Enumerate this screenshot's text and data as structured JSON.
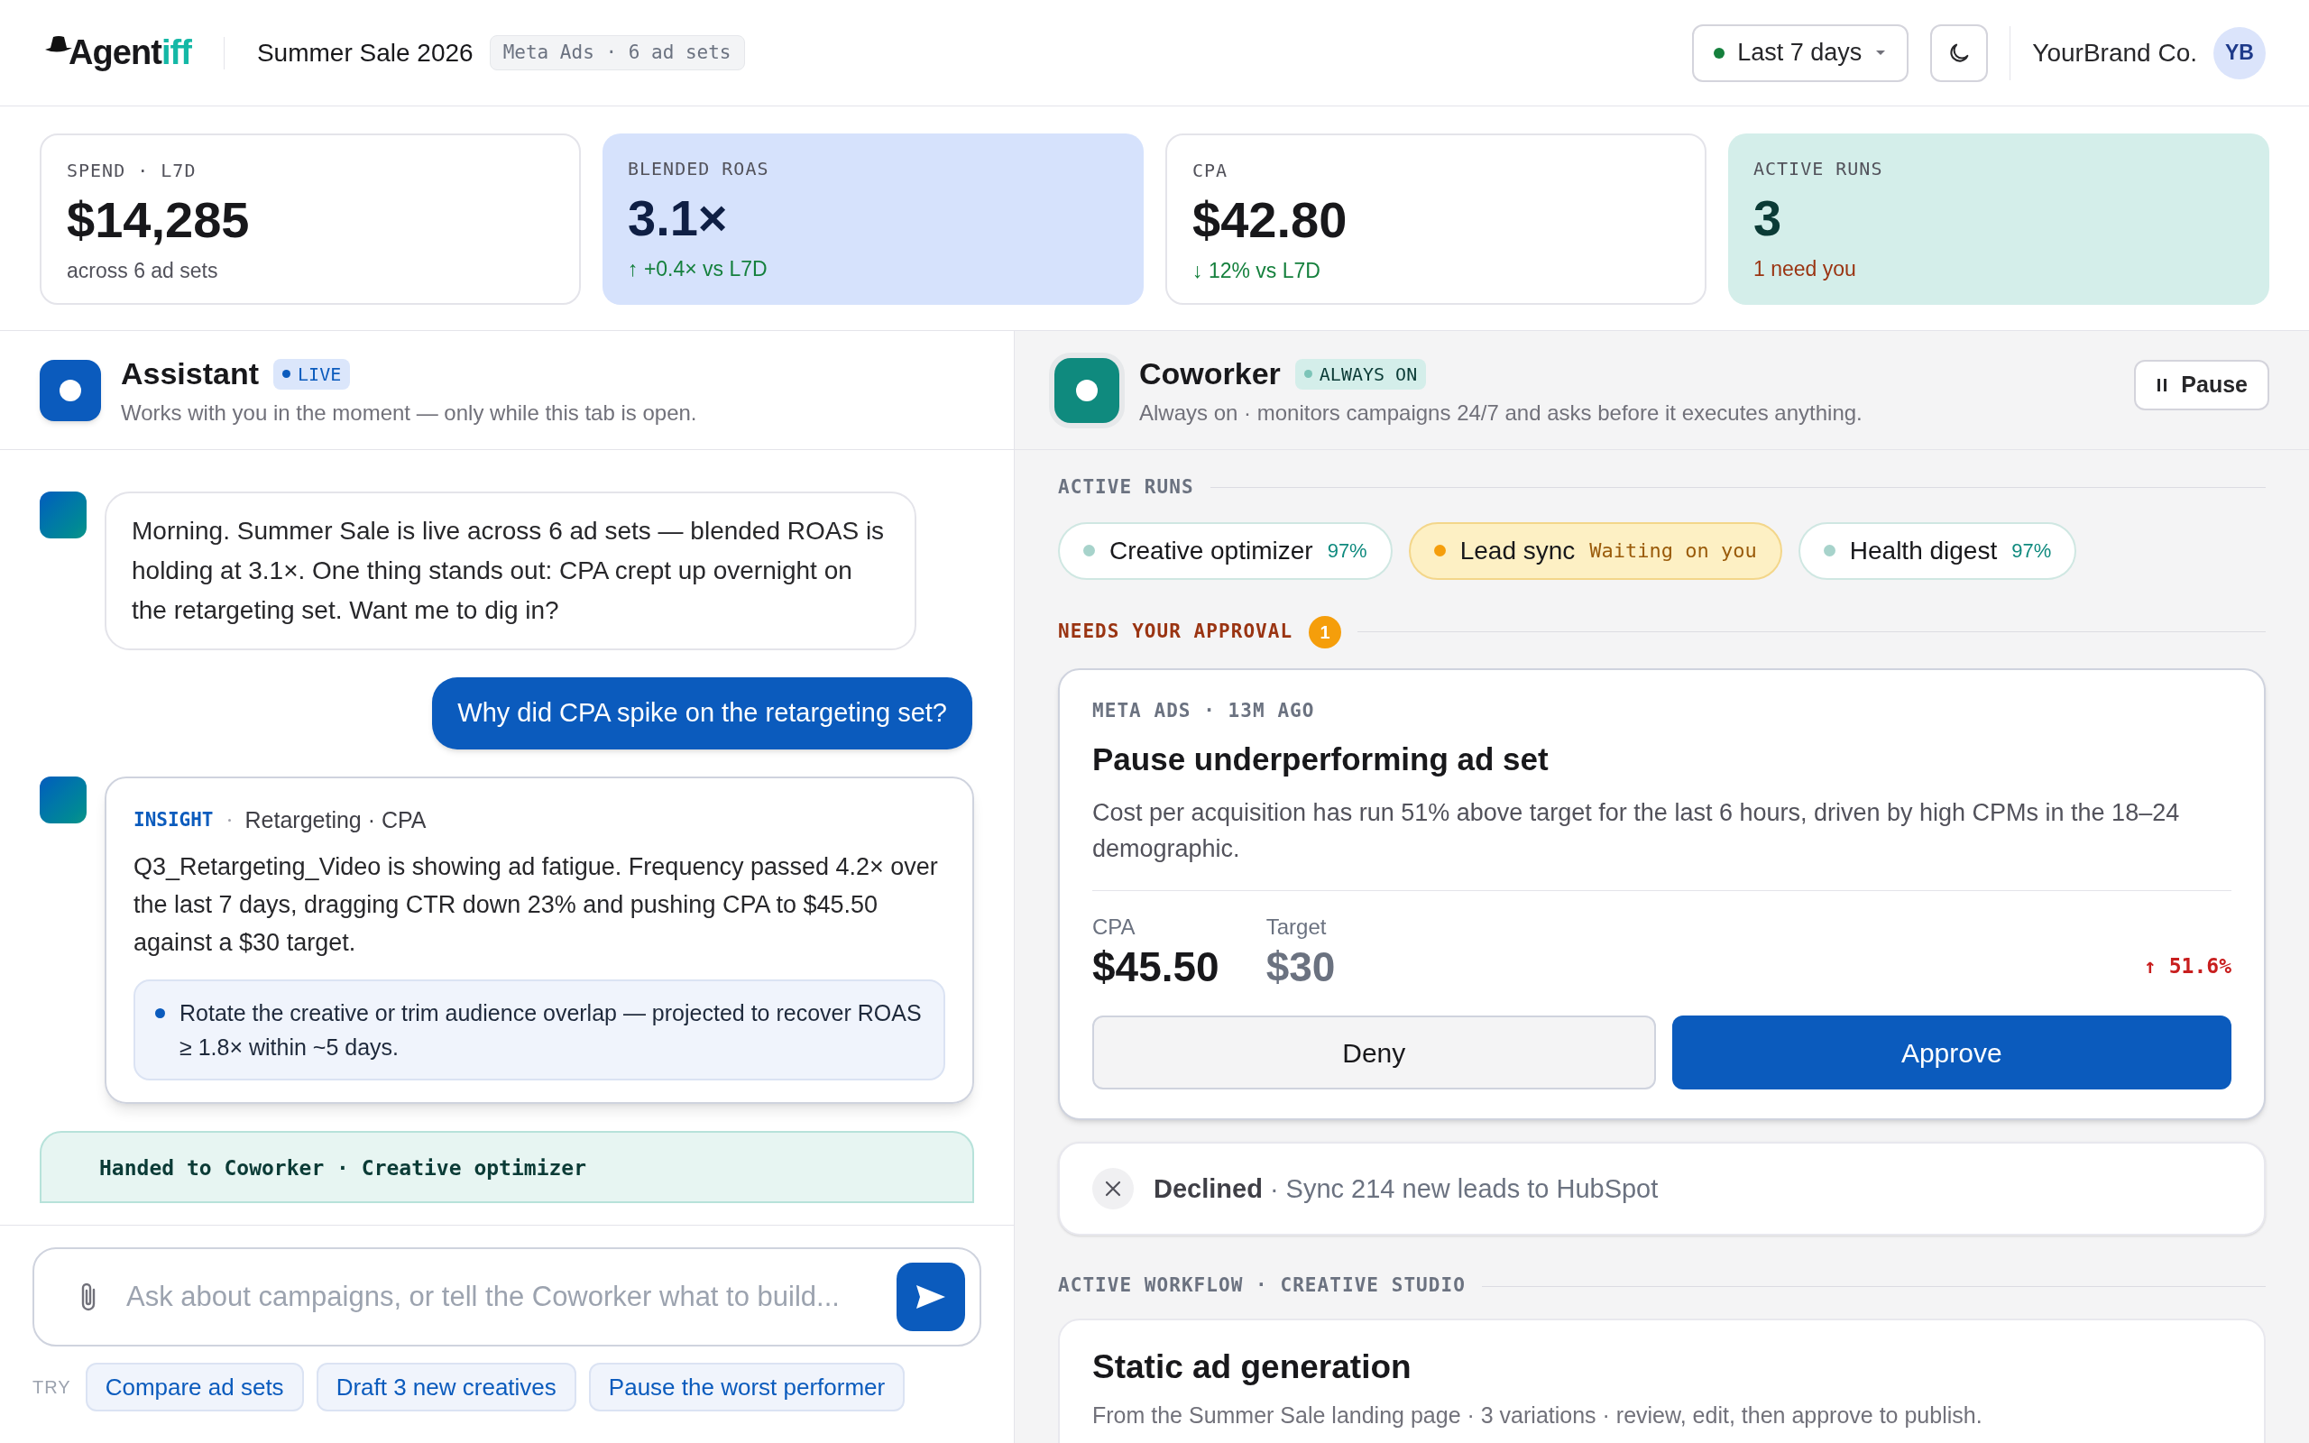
{
  "header": {
    "logo": {
      "text": "Agent",
      "accent": "iff"
    },
    "campaign": "Summer Sale 2026",
    "campaign_tag": "Meta Ads · 6 ad sets",
    "date_range": "Last 7 days",
    "account": "YourBrand Co.",
    "avatar": "YB"
  },
  "kpis": [
    {
      "label": "SPEND · L7D",
      "value": "$14,285",
      "note": "across 6 ad sets"
    },
    {
      "label": "BLENDED ROAS",
      "value": "3.1×",
      "note": "↑ +0.4× vs L7D"
    },
    {
      "label": "CPA",
      "value": "$42.80",
      "note": "↓ 12% vs L7D"
    },
    {
      "label": "ACTIVE RUNS",
      "value": "3",
      "note": "1 need you"
    }
  ],
  "assistant": {
    "title": "Assistant",
    "badge": "LIVE",
    "subtitle": "Works with you in the moment — only while this tab is open.",
    "messages": [
      {
        "kind": "bot",
        "text": "Morning. Summer Sale is live across 6 ad sets — blended ROAS is holding at 3.1×. One thing stands out: CPA crept up overnight on the retargeting set. Want me to dig in?"
      },
      {
        "kind": "user",
        "text": "Why did CPA spike on the retargeting set?"
      },
      {
        "kind": "insight",
        "tag": "INSIGHT",
        "topic": "Retargeting · CPA",
        "text": "Q3_Retargeting_Video is showing ad fatigue. Frequency passed 4.2× over the last 7 days, dragging CTR down 23% and pushing CPA to $45.50 against a $30 target.",
        "suggestion": "Rotate the creative or trim audience overlap — projected to recover ROAS ≥ 1.8× within ~5 days."
      },
      {
        "kind": "handoff",
        "text": "Handed to Coworker · Creative optimizer"
      }
    ],
    "composer": {
      "placeholder": "Ask about campaigns, or tell the Coworker what to build..."
    },
    "try_label": "TRY",
    "suggestions": [
      "Compare ad sets",
      "Draft 3 new creatives",
      "Pause the worst performer"
    ]
  },
  "coworker": {
    "title": "Coworker",
    "badge": "ALWAYS ON",
    "subtitle": "Always on · monitors campaigns 24/7 and asks before it executes anything.",
    "pause_button": "Pause",
    "active_runs_label": "ACTIVE RUNS",
    "runs": [
      {
        "name": "Creative optimizer",
        "status": "97%",
        "waiting": false,
        "color": "#a7d3cb"
      },
      {
        "name": "Lead sync",
        "status": "Waiting on you",
        "waiting": true,
        "color": "#f59e0b"
      },
      {
        "name": "Health digest",
        "status": "97%",
        "waiting": false,
        "color": "#a7d3cb"
      }
    ],
    "approval_label": "NEEDS YOUR APPROVAL",
    "approval_count": "1",
    "approval": {
      "meta": "META ADS · 13M AGO",
      "title": "Pause underperforming ad set",
      "text": "Cost per acquisition has run 51% above target for the last 6 hours, driven by high CPMs in the 18–24 demographic.",
      "metric_label": "CPA",
      "metric_value": "$45.50",
      "target_label": "Target",
      "target_value": "$30",
      "change": "↑ 51.6%",
      "deny": "Deny",
      "approve": "Approve"
    },
    "declined": {
      "status": "Declined",
      "text": "· Sync 214 new leads to HubSpot"
    },
    "workflow_label": "ACTIVE WORKFLOW · CREATIVE STUDIO",
    "workflow": {
      "title": "Static ad generation",
      "text": "From the Summer Sale landing page · 3 variations · review, edit, then approve to publish."
    }
  }
}
